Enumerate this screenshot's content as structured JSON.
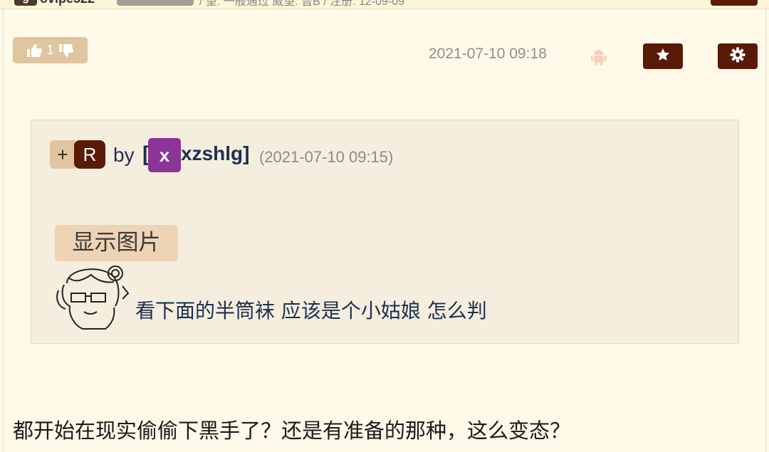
{
  "top_bar": {
    "badge_letter": "g",
    "username_partial": "ovipe522",
    "meta_partial": "/ 望: 一般通过 威望: 普B / 注册: 12-09-09"
  },
  "post": {
    "vote_count": "1",
    "timestamp": "2021-07-10 09:18"
  },
  "quote": {
    "plus_label": "+",
    "r_badge": "R",
    "by_label": "by",
    "open_bracket": "[",
    "avatar_letter": "x",
    "username": "xzshlg]",
    "date": "(2021-07-10 09:15)",
    "show_images_button": "显示图片",
    "text": "看下面的半筒袜 应该是个小姑娘 怎么判"
  },
  "reply_text": "都开始在现实偷偷下黑手了？还是有准备的那种，这么变态？",
  "colors": {
    "background": "#fef9e8",
    "accent_dark": "#5a1a08",
    "vote_bg": "#dfc5a0",
    "avatar_purple": "#8c3497",
    "link_blue": "#1e3050"
  },
  "icons": [
    "thumbs-up-icon",
    "thumbs-down-icon",
    "android-icon",
    "star-icon",
    "gear-icon"
  ]
}
